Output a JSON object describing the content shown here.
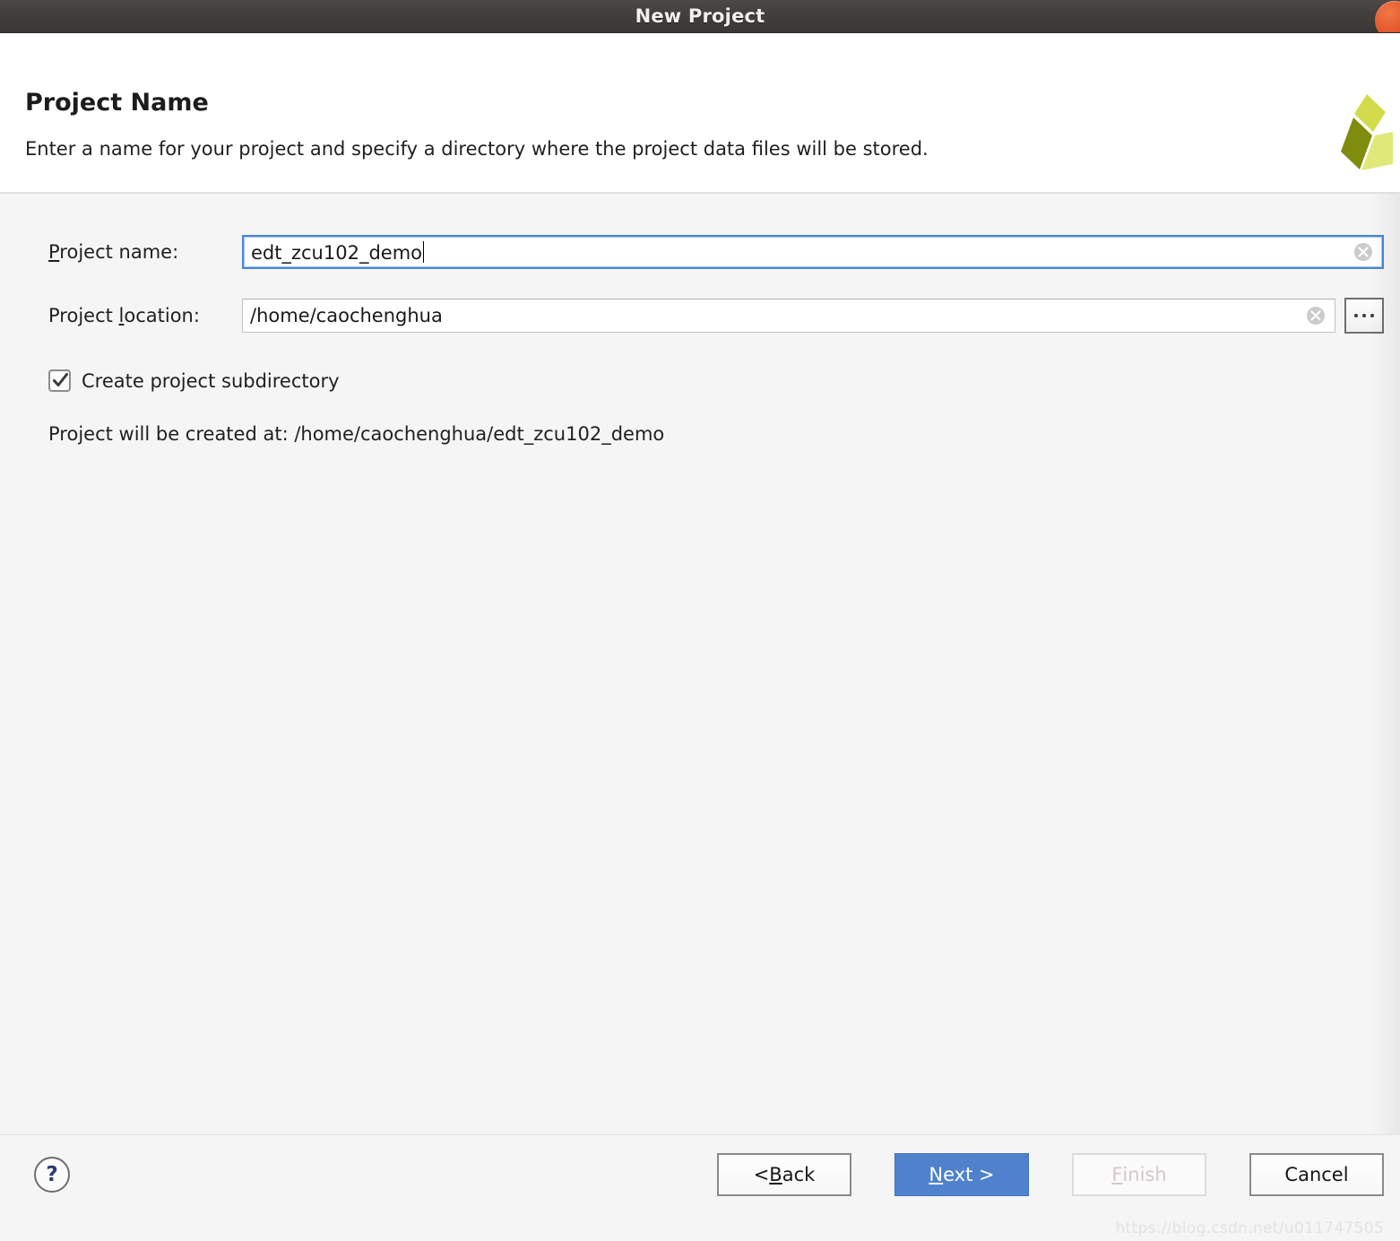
{
  "window": {
    "title": "New Project",
    "close_icon": "close-circle-icon"
  },
  "header": {
    "title": "Project Name",
    "subtitle": "Enter a name for your project and specify a directory where the project data files will be stored.",
    "logo_icon": "xilinx-pinwheel-logo",
    "logo_colors": {
      "light": "#d2dc4b",
      "mid": "#e0e87a",
      "dark": "#7f8c0e"
    }
  },
  "form": {
    "project_name": {
      "label_prefix": "",
      "label_mnemonic": "P",
      "label_suffix": "roject name:",
      "label_full": "Project name:",
      "value": "edt_zcu102_demo",
      "placeholder": "",
      "focused": true,
      "clear_icon": "clear-circle-icon"
    },
    "project_location": {
      "label_prefix": "Project ",
      "label_mnemonic": "l",
      "label_suffix": "ocation:",
      "label_full": "Project location:",
      "value": "/home/caochenghua",
      "placeholder": "",
      "focused": false,
      "clear_icon": "clear-circle-icon",
      "browse_label": "...",
      "browse_icon": "ellipsis-icon"
    },
    "create_subdirectory": {
      "label": "Create project subdirectory",
      "checked": true,
      "check_icon": "checkmark-icon"
    },
    "created_at": "Project will be created at: /home/caochenghua/edt_zcu102_demo"
  },
  "footer": {
    "help_icon": "question-mark-icon",
    "help_label": "?",
    "buttons": [
      {
        "name": "back",
        "prefix": "< ",
        "mnemonic": "B",
        "suffix": "ack",
        "full": "< Back",
        "state": "normal"
      },
      {
        "name": "next",
        "prefix": "",
        "mnemonic": "N",
        "suffix": "ext >",
        "full": "Next >",
        "state": "primary"
      },
      {
        "name": "finish",
        "prefix": "",
        "mnemonic": "F",
        "suffix": "inish",
        "full": "Finish",
        "state": "disabled"
      },
      {
        "name": "cancel",
        "prefix": "",
        "mnemonic": "",
        "suffix": "Cancel",
        "full": "Cancel",
        "state": "normal"
      }
    ]
  },
  "watermark": "https://blog.csdn.net/u011747505",
  "colors": {
    "titlebar": "#413e3b",
    "accent_blue": "#4f81cd",
    "focus_blue": "#4a86d6",
    "body_bg": "#f5f5f5",
    "close_orange": "#e2562c"
  }
}
